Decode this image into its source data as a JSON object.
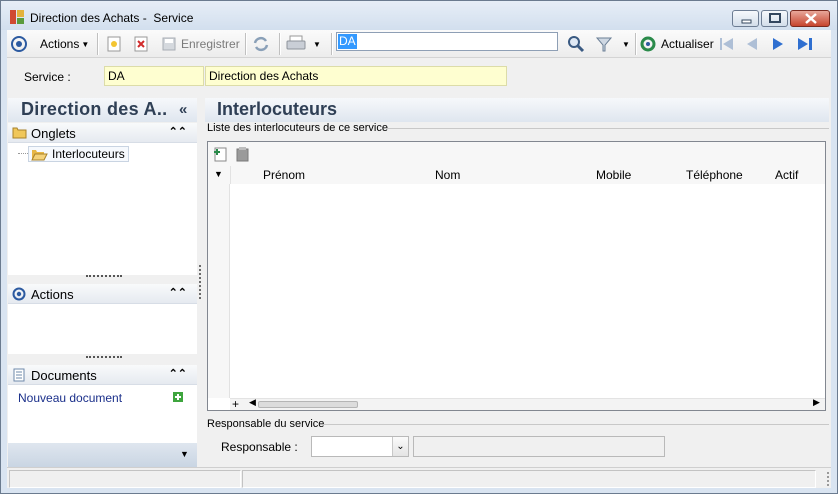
{
  "window": {
    "title": "Direction des Achats -  Service",
    "minimize_icon": "minimize-icon",
    "maximize_icon": "maximize-icon",
    "close_icon": "close-icon"
  },
  "toolbar": {
    "actions_label": "Actions",
    "save_label": "Enregistrer",
    "search_value": "DA",
    "refresh_label": "Actualiser"
  },
  "service": {
    "label": "Service :",
    "code": "DA",
    "name": "Direction des Achats"
  },
  "left_panel": {
    "title": "Direction des A..",
    "collapse_glyph": "«",
    "sections": {
      "onglets": {
        "title": "Onglets",
        "items": [
          {
            "label": "Interlocuteurs"
          }
        ]
      },
      "actions": {
        "title": "Actions"
      },
      "documents": {
        "title": "Documents",
        "new_doc_label": "Nouveau document"
      }
    }
  },
  "main": {
    "title": "Interlocuteurs",
    "group_label": "Liste des interlocuteurs de ce service",
    "columns": [
      "Prénom",
      "Nom",
      "Mobile",
      "Téléphone",
      "Actif"
    ],
    "rows": [],
    "responsable_group": "Responsable du service",
    "responsable_label": "Responsable :",
    "responsable_value": "",
    "add_row_glyph": "+"
  },
  "colors": {
    "accent": "#2f3f55",
    "field_highlight": "#fefed0",
    "selection": "#3399ff"
  }
}
